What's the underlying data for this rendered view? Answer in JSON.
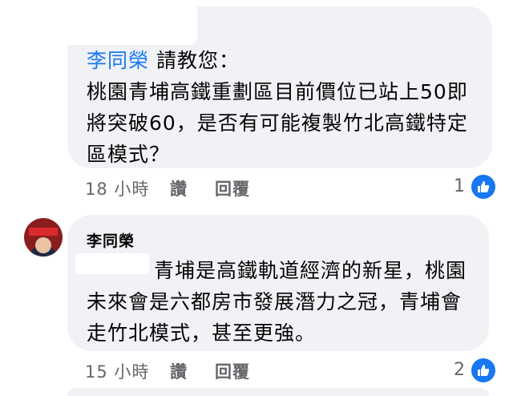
{
  "comments": [
    {
      "mention": "李同榮",
      "text_line1": " 請教您：",
      "text_rest": "桃園青埔高鐵重劃區目前價位已站上50即將突破60，是否有可能複製竹北高鐵特定區模式？",
      "time": "18 小時",
      "like_label": "讚",
      "reply_label": "回覆",
      "reaction_count": "1"
    },
    {
      "author": "李同榮",
      "text": "青埔是高鐵軌道經濟的新星，桃園未來會是六都房市發展潛力之冠，青埔會走竹北模式，甚至更強。",
      "time": "15 小時",
      "like_label": "讚",
      "reply_label": "回覆",
      "reaction_count": "2"
    }
  ],
  "icons": {
    "reaction": "thumbs-up-icon"
  },
  "colors": {
    "accent": "#1877f2",
    "bubble": "#f0f2f5",
    "meta": "#65676b"
  }
}
